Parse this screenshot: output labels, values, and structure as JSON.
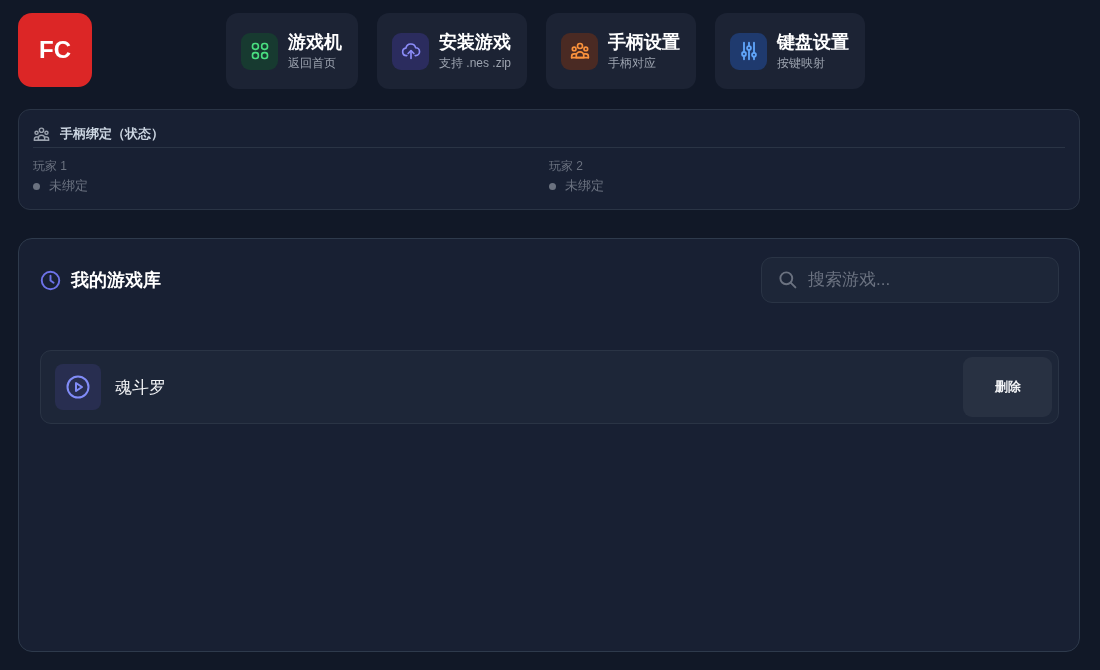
{
  "logo": {
    "text": "FC"
  },
  "nav": [
    {
      "kind": "home",
      "title": "游戏机",
      "subtitle": "返回首页"
    },
    {
      "kind": "install",
      "title": "安装游戏",
      "subtitle": "支持 .nes .zip"
    },
    {
      "kind": "controller",
      "title": "手柄设置",
      "subtitle": "手柄对应"
    },
    {
      "kind": "keyboard",
      "title": "键盘设置",
      "subtitle": "按键映射"
    }
  ],
  "binding": {
    "title": "手柄绑定（状态）",
    "players": [
      {
        "label": "玩家 1",
        "status": "未绑定",
        "bound": false
      },
      {
        "label": "玩家 2",
        "status": "未绑定",
        "bound": false
      }
    ]
  },
  "library": {
    "title": "我的游戏库",
    "search": {
      "placeholder": "搜索游戏..."
    },
    "games": [
      {
        "name": "魂斗罗",
        "action": "删除"
      }
    ]
  }
}
